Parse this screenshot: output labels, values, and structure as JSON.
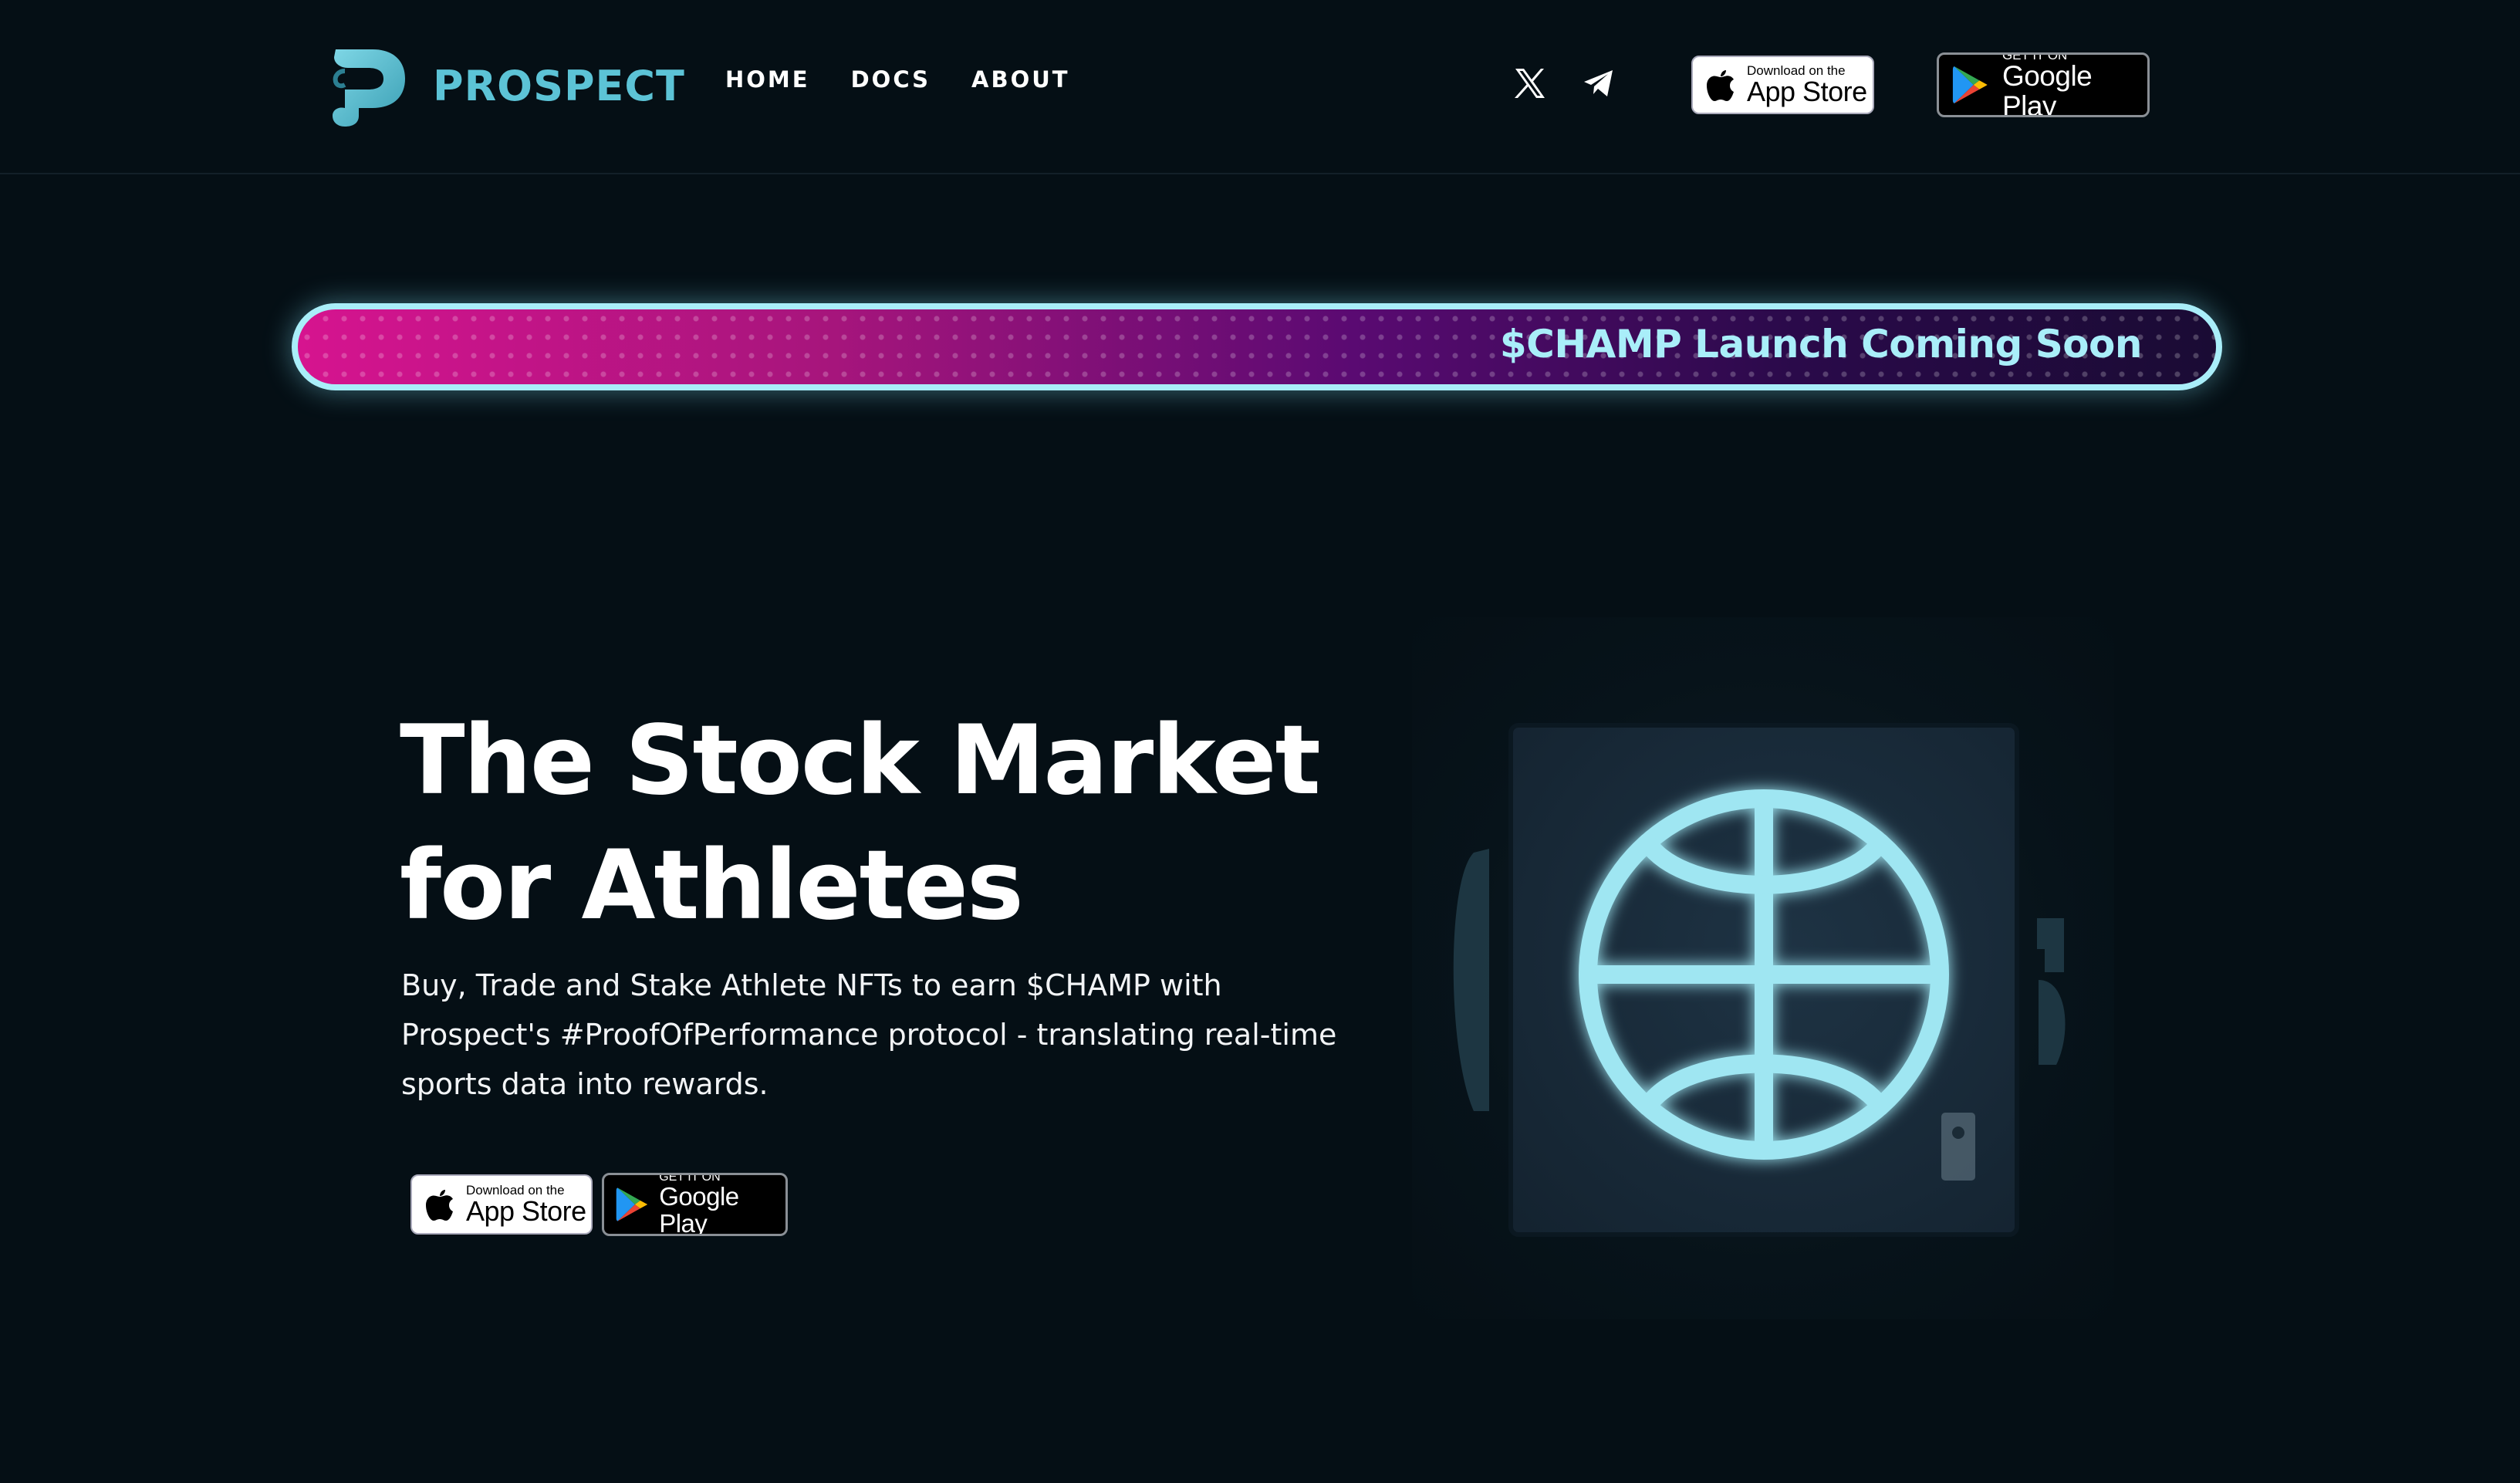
{
  "header": {
    "brand": "PROSPECT",
    "nav": [
      {
        "label": "HOME"
      },
      {
        "label": "DOCS"
      },
      {
        "label": "ABOUT"
      }
    ],
    "social": [
      {
        "icon": "x-twitter-icon"
      },
      {
        "icon": "telegram-icon"
      }
    ],
    "app_store": {
      "small": "Download on the",
      "big": "App Store"
    },
    "google_play": {
      "small": "GET IT ON",
      "big": "Google Play"
    }
  },
  "banner": {
    "text": "$CHAMP Launch Coming Soon"
  },
  "hero": {
    "title_line1": "The Stock Market",
    "title_line2": "for Athletes",
    "description": "Buy, Trade and Stake Athlete NFTs to earn $CHAMP with Prospect's #ProofOfPerformance protocol - translating real-time sports data into rewards.",
    "app_store": {
      "small": "Download on the",
      "big": "App Store"
    },
    "google_play": {
      "small": "GET IT ON",
      "big": "Google Play"
    }
  },
  "colors": {
    "background": "#050f15",
    "brand_teal": "#5cc3d6",
    "banner_border": "#a9eef9",
    "banner_pink": "#d6148f",
    "neon_ball": "#9fe6f2"
  }
}
